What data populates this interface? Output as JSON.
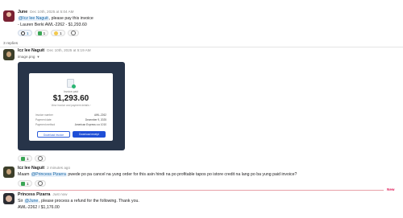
{
  "messages": {
    "m1": {
      "author": "June",
      "time": "Dec 10th, 2025 at 5:04 AM",
      "mention": "@Icz lee Naguit",
      "text_after_mention": ", please pay this invoice",
      "line2": "- Lauren Berki AWL-2262 - $1,293.60",
      "reactions": [
        {
          "icon": "eyes-icon",
          "count": "1"
        },
        {
          "icon": "check-icon",
          "count": "1"
        },
        {
          "icon": "coin-icon",
          "count": "1"
        }
      ]
    },
    "replies_label": "3 replies",
    "m2": {
      "author": "Icz lee Naguit",
      "time": "Dec 10th, 2025 at 5:19 AM",
      "file_name": "image.png",
      "invoice": {
        "paid_label": "Invoice paid",
        "amount": "$1,293.60",
        "view_text": "View invoice and payment details ›",
        "rows": [
          {
            "label": "Invoice number",
            "value": "AWL-2262"
          },
          {
            "label": "Payment date",
            "value": "December 9, 2025"
          },
          {
            "label": "Payment method",
            "value": "American Express •••• 1010"
          }
        ],
        "download_invoice": "Download invoice",
        "download_receipt": "Download receipt"
      },
      "reaction_count": "1"
    },
    "m3": {
      "author": "Icz lee Naguit",
      "time": "2 minutes ago",
      "prefix": "Maam ",
      "mention": "@Princess Pizarra",
      "text_after_mention": " pwede po pa cancel na yung order for this asin hindi na  po profitable  tapos po istore credit na lang po ba yung paid invoice?",
      "reaction_count": "1"
    },
    "new_label": "New",
    "m4": {
      "author": "Princess Pizarra",
      "time": "Just now",
      "prefix": "Sir ",
      "mention": "@June",
      "text_after_mention": ", please process a refund for the following. Thank you.",
      "line2": "AWL-2262 / $1,176.00"
    }
  }
}
